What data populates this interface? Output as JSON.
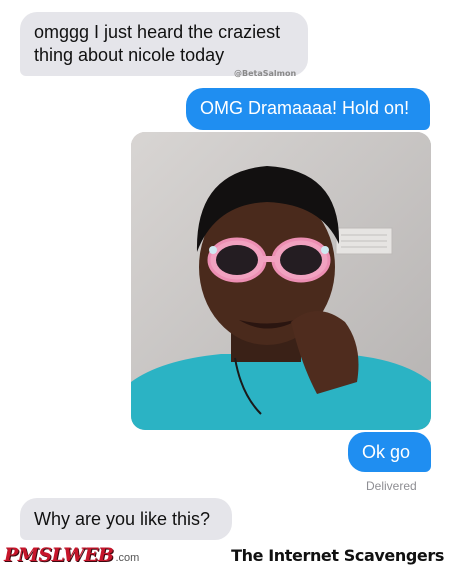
{
  "conversation": {
    "messages": [
      {
        "direction": "incoming",
        "text": "omggg I just heard the craziest thing about nicole today"
      },
      {
        "direction": "outgoing",
        "text": "OMG Dramaaaa! Hold on!"
      },
      {
        "direction": "outgoing",
        "text": "Ok go"
      },
      {
        "direction": "incoming",
        "text": "Why are you like this?"
      }
    ],
    "watermark_credit": "@BetaSalmon",
    "status": "Delivered",
    "photo_icon": "selfie-photo-icon"
  },
  "footer": {
    "logo_text": "PMSLWEB",
    "logo_tld": ".com",
    "credit": "The Internet Scavengers"
  },
  "colors": {
    "incoming_bubble": "#e5e5ea",
    "outgoing_bubble": "#1f8ef1",
    "logo_red": "#c7162b"
  }
}
